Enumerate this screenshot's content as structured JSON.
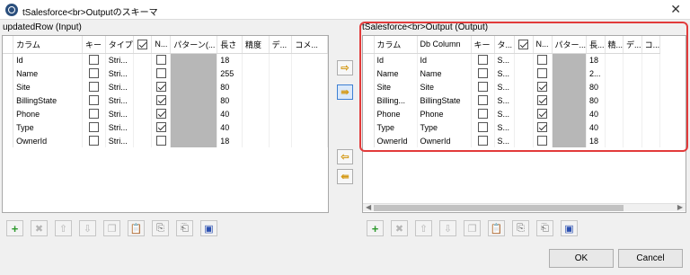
{
  "window": {
    "title": "tSalesforce<br>Outputのスキーマ",
    "close_label": "✕"
  },
  "left_panel": {
    "title": "updatedRow (Input)",
    "headers": [
      "",
      "カラム",
      "キー",
      "タイプ",
      "",
      "N...",
      "パターン(...",
      "長さ",
      "精度",
      "デ...",
      "コメ..."
    ],
    "rows": [
      {
        "index": "",
        "column": "Id",
        "type": "Stri...",
        "key": false,
        "nullable": false,
        "length": "18"
      },
      {
        "index": "",
        "column": "Name",
        "type": "Stri...",
        "key": false,
        "nullable": false,
        "length": "255"
      },
      {
        "index": "",
        "column": "Site",
        "type": "Stri...",
        "key": false,
        "nullable": true,
        "length": "80"
      },
      {
        "index": "",
        "column": "BillingState",
        "type": "Stri...",
        "key": false,
        "nullable": true,
        "length": "80"
      },
      {
        "index": "",
        "column": "Phone",
        "type": "Stri...",
        "key": false,
        "nullable": true,
        "length": "40"
      },
      {
        "index": "",
        "column": "Type",
        "type": "Stri...",
        "key": false,
        "nullable": true,
        "length": "40"
      },
      {
        "index": "",
        "column": "OwnerId",
        "type": "Stri...",
        "key": false,
        "nullable": false,
        "length": "18"
      }
    ]
  },
  "right_panel": {
    "title": "tSalesforce<br>Output (Output)",
    "headers": [
      "",
      "カラム",
      "Db Column",
      "キー",
      "タ...",
      "",
      "N...",
      "パター...",
      "長...",
      "精...",
      "デ...",
      "コ..."
    ],
    "rows": [
      {
        "column": "Id",
        "db_column": "Id",
        "type": "S...",
        "key": false,
        "nullable": false,
        "length": "18"
      },
      {
        "column": "Name",
        "db_column": "Name",
        "type": "S...",
        "key": false,
        "nullable": false,
        "length": "2..."
      },
      {
        "column": "Site",
        "db_column": "Site",
        "type": "S...",
        "key": false,
        "nullable": true,
        "length": "80"
      },
      {
        "column": "Billing...",
        "db_column": "BillingState",
        "type": "S...",
        "key": false,
        "nullable": true,
        "length": "80"
      },
      {
        "column": "Phone",
        "db_column": "Phone",
        "type": "S...",
        "key": false,
        "nullable": true,
        "length": "40"
      },
      {
        "column": "Type",
        "db_column": "Type",
        "type": "S...",
        "key": false,
        "nullable": true,
        "length": "40"
      },
      {
        "column": "OwnerId",
        "db_column": "OwnerId",
        "type": "S...",
        "key": false,
        "nullable": false,
        "length": "18"
      }
    ]
  },
  "transfer_buttons": [
    {
      "name": "copy-selected-right-icon",
      "glyph": "⇨"
    },
    {
      "name": "copy-all-right-icon",
      "glyph": "⇛"
    },
    {
      "name": "copy-selected-left-icon",
      "glyph": "⇦"
    },
    {
      "name": "copy-all-left-icon",
      "glyph": "⇚"
    }
  ],
  "toolbar_icons": [
    "add-icon",
    "remove-icon",
    "move-up-icon",
    "move-down-icon",
    "copy-icon",
    "paste-icon",
    "import-icon",
    "export-icon",
    "save-icon"
  ],
  "buttons": {
    "ok": "OK",
    "cancel": "Cancel"
  },
  "colors": {
    "highlight": "#e23b3b",
    "accent": "#3c7fd3"
  }
}
